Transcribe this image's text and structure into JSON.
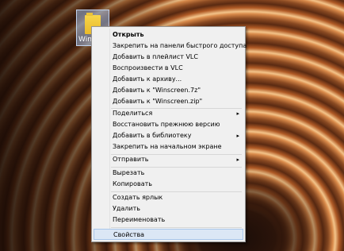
{
  "desktop": {
    "folder": {
      "label": "Winscr"
    }
  },
  "context_menu": {
    "items": [
      {
        "label": "Открыть",
        "bold": true
      },
      {
        "label": "Закрепить на панели быстрого доступа"
      },
      {
        "label": "Добавить в плейлист VLC"
      },
      {
        "label": "Воспроизвести в VLC"
      },
      {
        "label": "Добавить к архиву..."
      },
      {
        "label": "Добавить к \"Winscreen.7z\""
      },
      {
        "label": "Добавить к \"Winscreen.zip\""
      },
      {
        "label": "Поделиться",
        "submenu": true
      },
      {
        "label": "Восстановить прежнюю версию"
      },
      {
        "label": "Добавить в библиотеку",
        "submenu": true
      },
      {
        "label": "Закрепить на начальном экране"
      },
      {
        "label": "Отправить",
        "submenu": true
      },
      {
        "label": "Вырезать"
      },
      {
        "label": "Копировать"
      },
      {
        "label": "Создать ярлык"
      },
      {
        "label": "Удалить"
      },
      {
        "label": "Переименовать"
      },
      {
        "label": "Свойства",
        "highlighted": true
      }
    ],
    "submenu_arrow": "▸"
  }
}
